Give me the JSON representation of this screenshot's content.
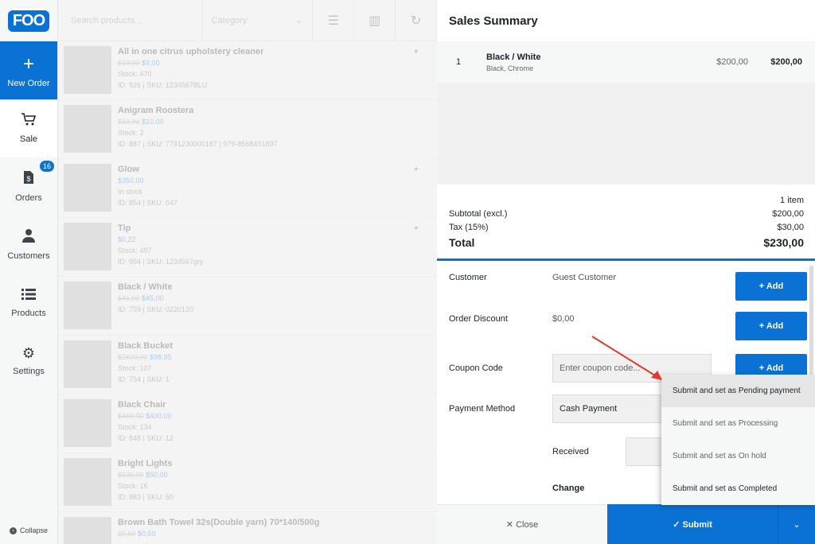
{
  "logo": "FOO",
  "sidebar": {
    "items": [
      {
        "label": "New Order",
        "icon": "plus-icon"
      },
      {
        "label": "Sale",
        "icon": "cart-icon"
      },
      {
        "label": "Orders",
        "icon": "orders-icon",
        "badge": "16"
      },
      {
        "label": "Customers",
        "icon": "user-icon"
      },
      {
        "label": "Products",
        "icon": "list-icon"
      },
      {
        "label": "Settings",
        "icon": "gear-icon"
      }
    ],
    "collapse": "Collapse"
  },
  "toolbar": {
    "search_placeholder": "Search products...",
    "category": "Category"
  },
  "products": [
    {
      "name": "All in one citrus upholstery cleaner",
      "old": "$10,00",
      "new": "$9,00",
      "stock": "Stock: 470",
      "id": "ID: 926 | SKU: 1234567BLU"
    },
    {
      "name": "Anigram Roostera",
      "old": "$10,94",
      "new": "$10,00",
      "stock": "Stock: 2",
      "id": "ID: 887 | SKU: 7791230000187 | 979-8568401897"
    },
    {
      "name": "Glow",
      "old": "",
      "new": "$350,00",
      "stock": "In stock",
      "id": "ID: 854 | SKU: 047"
    },
    {
      "name": "Tip",
      "old": "",
      "new": "$0,22",
      "stock": "Stock: 497",
      "id": "ID: 954 | SKU: 1234567gry"
    },
    {
      "name": "Black / White",
      "old": "$46,00",
      "new": "$45,00",
      "stock": "",
      "id": "ID: 759 | SKU: 0220120"
    },
    {
      "name": "Black Bucket",
      "old": "$2600,00",
      "new": "$98,95",
      "stock": "Stock: 107",
      "id": "ID: 754 | SKU: 1"
    },
    {
      "name": "Black Chair",
      "old": "$460,00",
      "new": "$400,00",
      "stock": "Stock: 134",
      "id": "ID: 848 | SKU: 12"
    },
    {
      "name": "Bright Lights",
      "old": "$136,00",
      "new": "$50,00",
      "stock": "Stock: 16",
      "id": "ID: 883 | SKU: 50"
    },
    {
      "name": "Brown Bath Towel 32s(Double yarn) 70*140/500g",
      "old": "$0,60",
      "new": "$0,50",
      "stock": "",
      "id": ""
    }
  ],
  "summary": {
    "title": "Sales Summary",
    "line": {
      "qty": "1",
      "name": "Black / White",
      "variant": "Black, Chrome",
      "price": "$200,00",
      "total": "$200,00"
    },
    "items_count": "1 item",
    "subtotal_label": "Subtotal (excl.)",
    "subtotal": "$200,00",
    "tax_label": "Tax (15%)",
    "tax": "$30,00",
    "total_label": "Total",
    "total": "$230,00"
  },
  "form": {
    "customer_label": "Customer",
    "customer_value": "Guest Customer",
    "discount_label": "Order Discount",
    "discount_value": "$0,00",
    "coupon_label": "Coupon Code",
    "coupon_placeholder": "Enter coupon code...",
    "payment_label": "Payment Method",
    "payment_value": "Cash Payment",
    "received_label": "Received",
    "change_label": "Change",
    "add_label": "+ Add"
  },
  "footer": {
    "close": "✕  Close",
    "submit": "✓  Submit"
  },
  "dropdown": [
    "Submit and set as Pending payment",
    "Submit and set as Processing",
    "Submit and set as On hold",
    "Submit and set as Completed"
  ],
  "colors": {
    "accent": "#0a72d4",
    "arrow": "#e03b2f"
  }
}
